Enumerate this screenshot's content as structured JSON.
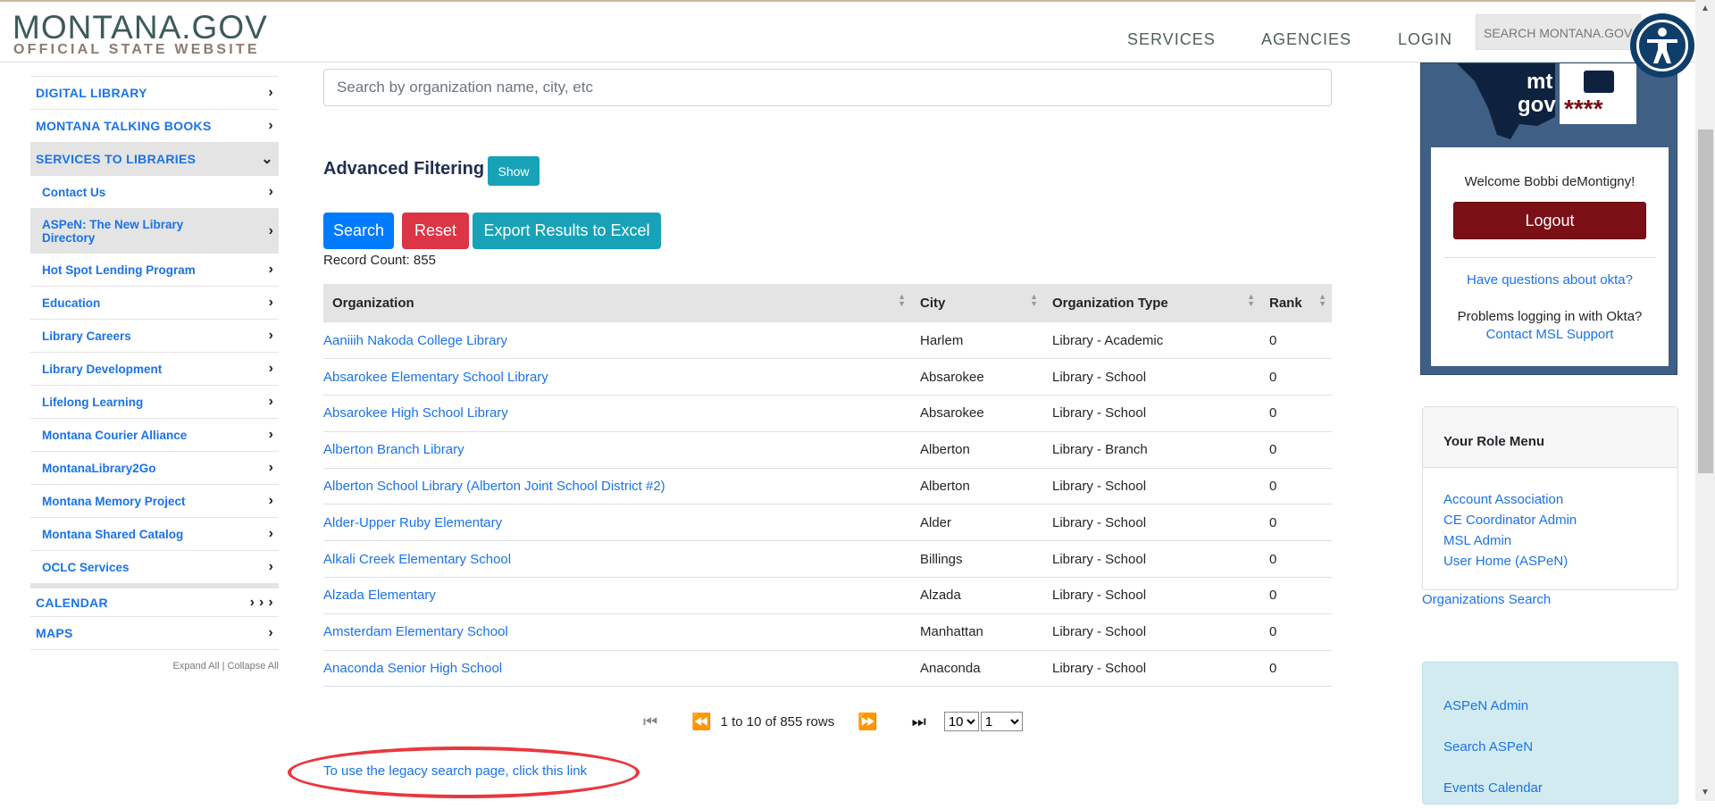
{
  "header": {
    "logo_main": "MONTANA.GOV",
    "logo_sub": "OFFICIAL STATE WEBSITE",
    "nav": [
      "SERVICES",
      "AGENCIES",
      "LOGIN"
    ],
    "search_placeholder": "SEARCH MONTANA.GOV",
    "accessibility_icon": "accessibility-icon"
  },
  "sidebar": {
    "items": [
      {
        "label": "DIGITAL LIBRARY",
        "type": "top"
      },
      {
        "label": "MONTANA TALKING BOOKS",
        "type": "top"
      },
      {
        "label": "SERVICES TO LIBRARIES",
        "type": "top",
        "expanded": true
      },
      {
        "label": "Contact Us",
        "type": "sub"
      },
      {
        "label": "ASPeN: The New Library Directory",
        "type": "sub",
        "active": true
      },
      {
        "label": "Hot Spot Lending Program",
        "type": "sub"
      },
      {
        "label": "Education",
        "type": "sub"
      },
      {
        "label": "Library Careers",
        "type": "sub"
      },
      {
        "label": "Library Development",
        "type": "sub"
      },
      {
        "label": "Lifelong Learning",
        "type": "sub"
      },
      {
        "label": "Montana Courier Alliance",
        "type": "sub"
      },
      {
        "label": "MontanaLibrary2Go",
        "type": "sub"
      },
      {
        "label": "Montana Memory Project",
        "type": "sub"
      },
      {
        "label": "Montana Shared Catalog",
        "type": "sub"
      },
      {
        "label": "OCLC Services",
        "type": "sub"
      },
      {
        "label": "CALENDAR",
        "type": "top"
      },
      {
        "label": "MAPS",
        "type": "top"
      }
    ],
    "expand_all": "Expand All",
    "collapse_all": "Collapse All",
    "separator": "|"
  },
  "main": {
    "search_placeholder": "Search by organization name, city, etc",
    "advanced_label": "Advanced Filtering",
    "show_label": "Show",
    "search_btn": "Search",
    "reset_btn": "Reset",
    "export_btn": "Export Results to Excel",
    "record_count": "Record Count: 855",
    "columns": [
      "Organization",
      "City",
      "Organization Type",
      "Rank"
    ],
    "rows": [
      [
        "Aaniiih Nakoda College Library",
        "Harlem",
        "Library - Academic",
        "0"
      ],
      [
        "Absarokee Elementary School Library",
        "Absarokee",
        "Library - School",
        "0"
      ],
      [
        "Absarokee High School Library",
        "Absarokee",
        "Library - School",
        "0"
      ],
      [
        "Alberton Branch Library",
        "Alberton",
        "Library - Branch",
        "0"
      ],
      [
        "Alberton School Library (Alberton Joint School District #2)",
        "Alberton",
        "Library - School",
        "0"
      ],
      [
        "Alder-Upper Ruby Elementary",
        "Alder",
        "Library - School",
        "0"
      ],
      [
        "Alkali Creek Elementary School",
        "Billings",
        "Library - School",
        "0"
      ],
      [
        "Alzada Elementary",
        "Alzada",
        "Library - School",
        "0"
      ],
      [
        "Amsterdam Elementary School",
        "Manhattan",
        "Library - School",
        "0"
      ],
      [
        "Anaconda Senior High School",
        "Anaconda",
        "Library - School",
        "0"
      ]
    ],
    "pager": {
      "text": "1 to 10 of 855 rows",
      "page_size": "10",
      "page": "1"
    },
    "legacy_link": "To use the legacy search page, click this link"
  },
  "right": {
    "okta_logo_text": [
      "mt",
      "gov"
    ],
    "welcome": "Welcome Bobbi deMontigny!",
    "logout": "Logout",
    "okta_question": "Have questions about okta?",
    "problems": "Problems logging in with Okta?",
    "contact": "Contact MSL Support",
    "role_title": "Your Role Menu",
    "role_items": [
      "Account Association",
      "CE Coordinator Admin",
      "MSL Admin",
      "User Home (ASPeN)"
    ],
    "org_search": "Organizations Search",
    "cyan_items": [
      "ASPeN Admin",
      "Search ASPeN",
      "Events Calendar"
    ]
  },
  "colors": {
    "primary": "#007bff",
    "danger": "#dc3545",
    "info": "#17a2b8",
    "logout": "#7a1016",
    "okta_panel": "#3f5f85",
    "highlight": "#e8383e"
  }
}
